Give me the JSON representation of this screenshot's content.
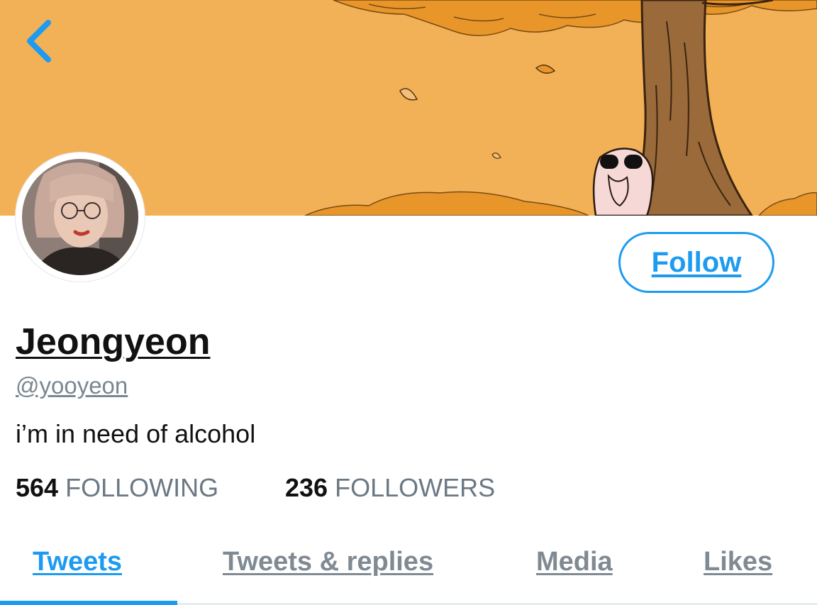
{
  "header": {
    "back_icon": "chevron-left-icon"
  },
  "profile": {
    "display_name": "Jeongyeon",
    "handle": "@yooyeon",
    "bio": "i’m in need of alcohol",
    "follow_label": "Follow"
  },
  "stats": {
    "following_count": "564",
    "following_label": "FOLLOWING",
    "followers_count": "236",
    "followers_label": "FOLLOWERS"
  },
  "tabs": [
    {
      "label": "Tweets",
      "active": true
    },
    {
      "label": "Tweets & replies",
      "active": false
    },
    {
      "label": "Media",
      "active": false
    },
    {
      "label": "Likes",
      "active": false
    }
  ],
  "colors": {
    "accent": "#1d9bf0",
    "banner": "#f2b157",
    "muted_text": "#6b7884"
  }
}
